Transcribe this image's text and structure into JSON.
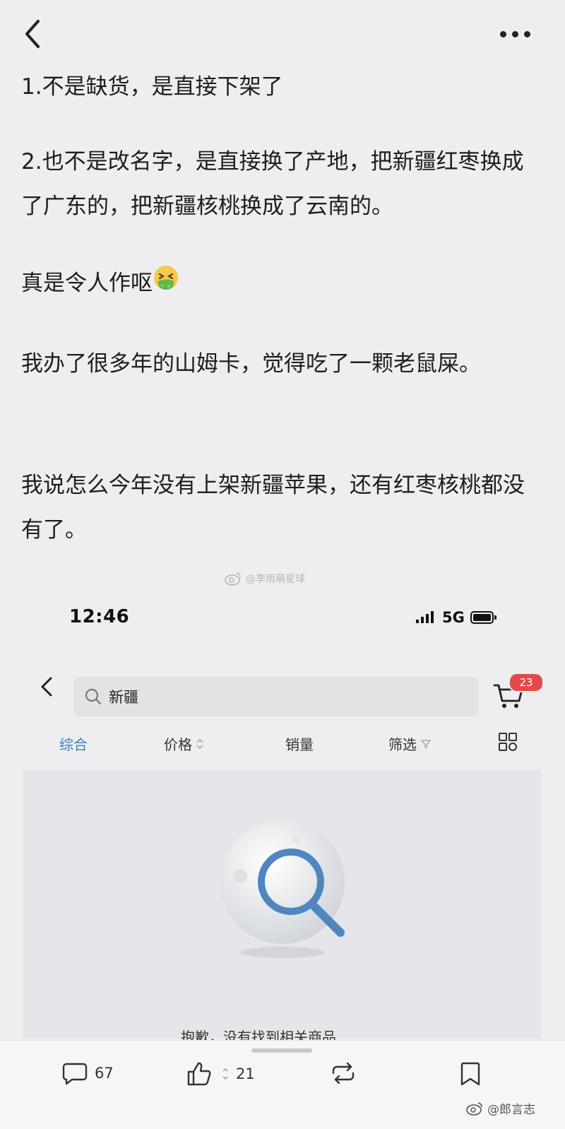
{
  "post": {
    "paragraphs": [
      "1.不是缺货，是直接下架了",
      "2.也不是改名字，是直接换了产地，把新疆红枣换成了广东的，把新疆核桃换成了云南的。",
      "真是令人作呕",
      "我办了很多年的山姆卡，觉得吃了一颗老鼠屎。",
      "我说怎么今年没有上架新疆苹果，还有红枣核桃都没有了。"
    ],
    "emoji": "nauseated-face",
    "watermark": "@李雨萌星球"
  },
  "embedded_screenshot": {
    "status_time": "12:46",
    "network": "5G",
    "search_query": "新疆",
    "cart_count": "23",
    "tabs": [
      "综合",
      "价格",
      "销量",
      "筛选"
    ],
    "active_tab": "综合",
    "empty_message": "抱歉，没有找到相关商品"
  },
  "actions": {
    "comment_count": "67",
    "like_count": "21"
  },
  "corner_watermark": "@郎言志",
  "colors": {
    "background": "#eeeef0",
    "accent_blue": "#3d7fc0",
    "badge_red": "#e44a4a"
  }
}
